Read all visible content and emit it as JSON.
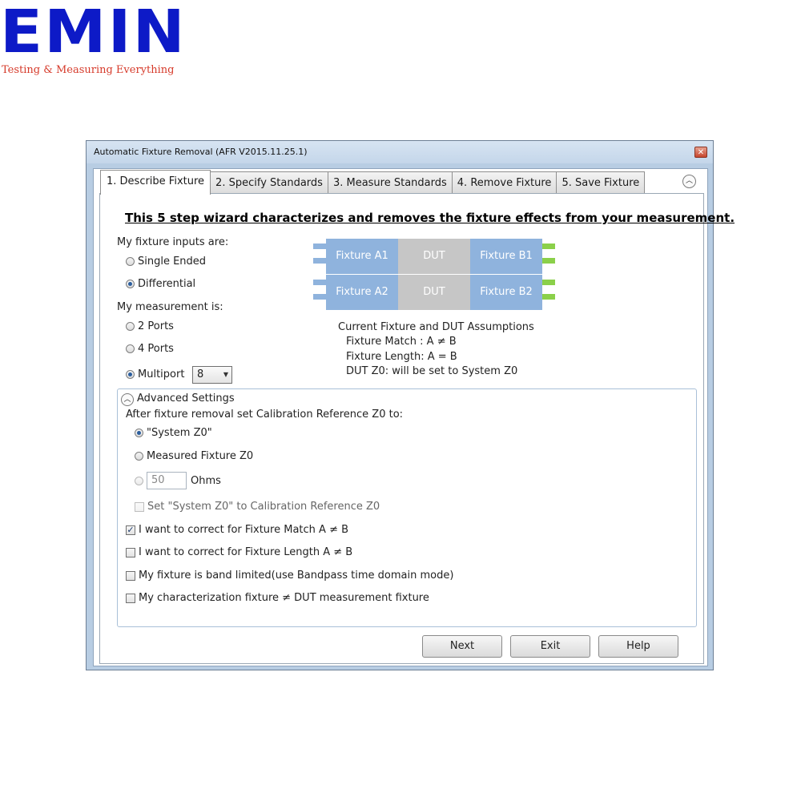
{
  "logo": {
    "word": "EMIN",
    "tagline": "Testing & Measuring Everything"
  },
  "window": {
    "title": "Automatic Fixture Removal (AFR V2015.11.25.1)"
  },
  "tabs": [
    {
      "label": "1. Describe Fixture"
    },
    {
      "label": "2. Specify Standards"
    },
    {
      "label": "3. Measure Standards"
    },
    {
      "label": "4. Remove Fixture"
    },
    {
      "label": "5. Save Fixture"
    }
  ],
  "heading": "This 5 step wizard characterizes and removes the fixture effects from your measurement.",
  "inputs": {
    "label": "My fixture inputs are:",
    "single": "Single Ended",
    "differential": "Differential",
    "selected": "Differential"
  },
  "measurement": {
    "label": "My measurement is:",
    "two": "2 Ports",
    "four": "4 Ports",
    "multi": "Multiport",
    "multiport_value": "8",
    "selected": "Multiport"
  },
  "diagram": {
    "a1": "Fixture A1",
    "a2": "Fixture A2",
    "b1": "Fixture B1",
    "b2": "Fixture B2",
    "dut": "DUT"
  },
  "assumptions": {
    "title": "Current Fixture and DUT Assumptions",
    "match": "Fixture Match : A ≠ B",
    "length": "Fixture Length: A = B",
    "z0": "DUT Z0: will be set to System Z0"
  },
  "advanced": {
    "title": "Advanced Settings",
    "after_label": "After fixture removal set Calibration Reference Z0 to:",
    "system_z0": "\"System Z0\"",
    "measured_z0": "Measured Fixture Z0",
    "custom_value": "50",
    "ohms": "Ohms",
    "set_system": "Set \"System Z0\" to Calibration Reference Z0",
    "correct_match": "I want to correct for Fixture Match A ≠ B",
    "correct_match_checked": true,
    "correct_length": "I want to correct for Fixture Length A ≠ B",
    "band_limited": "My fixture is band limited(use Bandpass time domain mode)",
    "char_fixture": "My characterization fixture ≠ DUT measurement fixture"
  },
  "buttons": {
    "next": "Next",
    "exit": "Exit",
    "help": "Help"
  }
}
